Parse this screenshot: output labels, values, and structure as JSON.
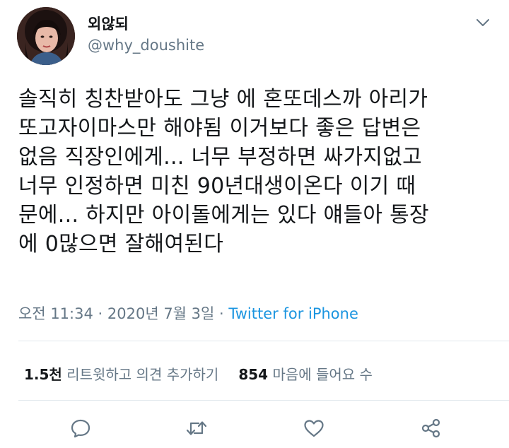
{
  "user": {
    "display_name": "외않되",
    "handle": "@why_doushite"
  },
  "tweet": {
    "text": "솔직히 칭찬받아도 그냥 에 혼또데스까 아리가\n또고자이마스만 해야됨 이거보다 좋은 답변은\n없음 직장인에게... 너무 부정하면 싸가지없고\n너무 인정하면 미친 90년대생이온다 이기 때\n문에... 하지만 아이돌에게는 있다 얘들아 통장\n에 0많으면 잘해여된다",
    "time": "오전 11:34",
    "date": "2020년 7월 3일",
    "separator": " · ",
    "source": "Twitter for iPhone"
  },
  "stats": {
    "retweets_count": "1.5천",
    "retweets_label": "리트윗하고 의견 추가하기",
    "likes_count": "854",
    "likes_label": "마음에 들어요 수"
  },
  "actions": {
    "reply_icon": "reply-icon",
    "retweet_icon": "retweet-icon",
    "like_icon": "heart-icon",
    "share_icon": "share-icon"
  },
  "colors": {
    "text": "#14171a",
    "secondary": "#657786",
    "link": "#1b95e0",
    "divider": "#e1e8ed"
  }
}
